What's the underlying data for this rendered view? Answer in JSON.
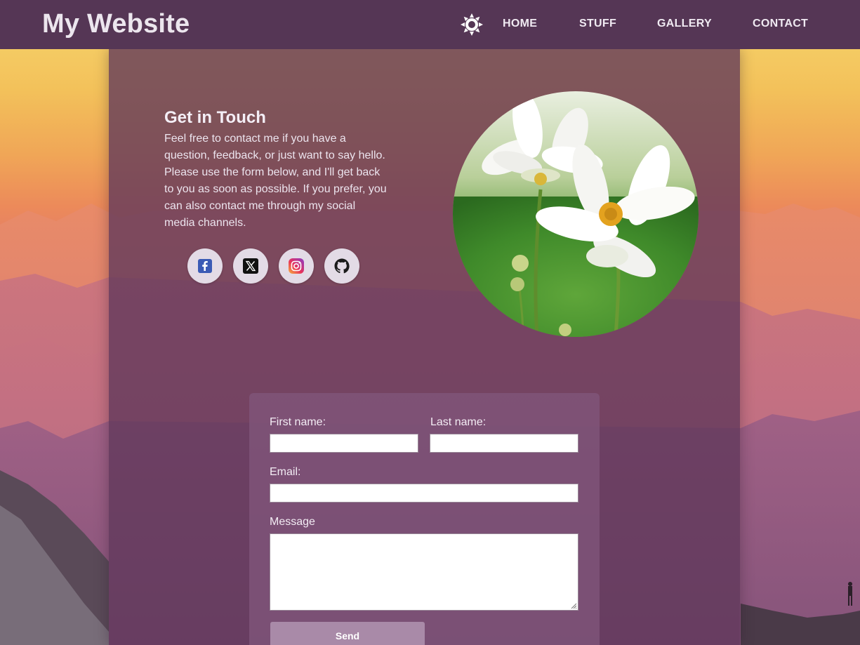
{
  "header": {
    "brand": "My Website",
    "theme_toggle_icon": "sun-icon",
    "nav": [
      "HOME",
      "STUFF",
      "GALLERY",
      "CONTACT"
    ]
  },
  "contact": {
    "title": "Get in Touch",
    "text": "Feel free to contact me if you have a question, feedback, or just want to say hello. Please use the form below, and I'll get back to you as soon as possible. If you prefer, you can also contact me through my social media channels.",
    "socials": [
      "facebook-icon",
      "x-twitter-icon",
      "instagram-icon",
      "github-icon"
    ]
  },
  "form": {
    "first_name_label": "First name:",
    "first_name_value": "",
    "last_name_label": "Last name:",
    "last_name_value": "",
    "email_label": "Email:",
    "email_value": "",
    "message_label": "Message",
    "message_value": "",
    "send_label": "Send"
  },
  "colors": {
    "header_bg": "#553655",
    "panel_bg": "#5f375a",
    "button_bg": "#a98aa8"
  }
}
